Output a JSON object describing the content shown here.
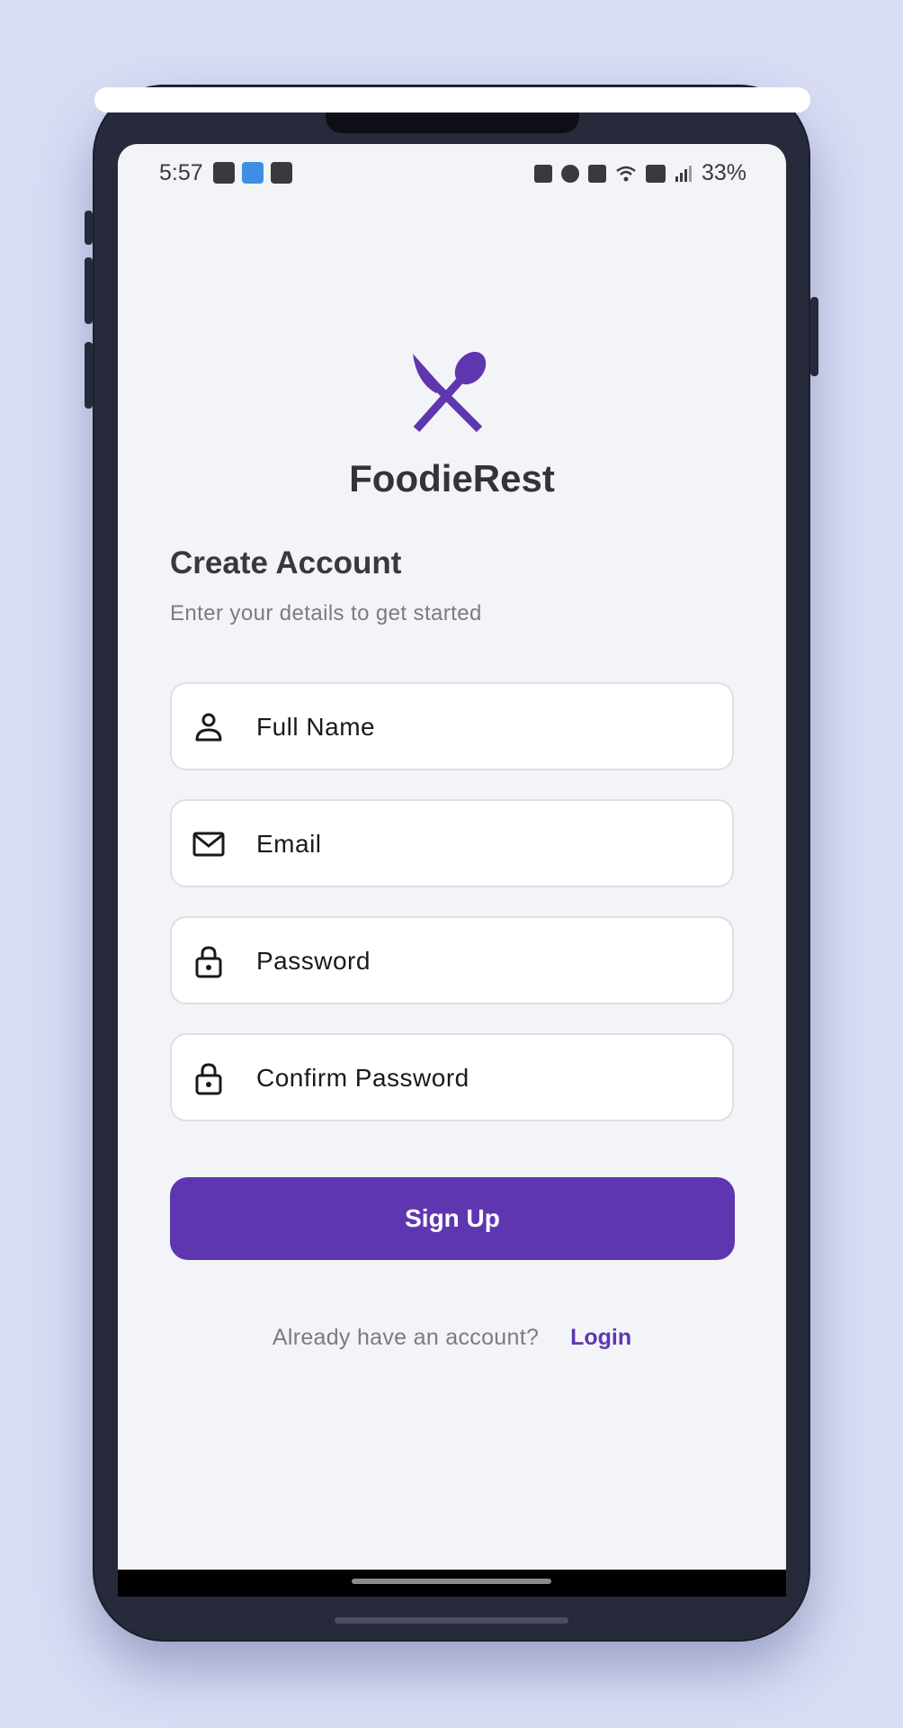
{
  "status_bar": {
    "time": "5:57",
    "left_icons": [
      "image-icon",
      "app-icon",
      "checkbox-icon"
    ],
    "right_icons": [
      "battery-saver-icon",
      "alarm-icon",
      "mute-icon",
      "wifi-icon",
      "volte-icon",
      "signal-icon"
    ],
    "battery": "33%"
  },
  "brand": {
    "logo_icon": "fork-spoon-icon",
    "name": "FoodieRest",
    "accent_color": "#5e37b0"
  },
  "form": {
    "title": "Create Account",
    "subtitle": "Enter your details to get started",
    "fields": [
      {
        "icon": "person-icon",
        "placeholder": "Full Name"
      },
      {
        "icon": "mail-icon",
        "placeholder": "Email"
      },
      {
        "icon": "lock-icon",
        "placeholder": "Password"
      },
      {
        "icon": "lock-icon",
        "placeholder": "Confirm Password"
      }
    ],
    "submit_label": "Sign Up"
  },
  "footer": {
    "question": "Already have an account?",
    "link_label": "Login"
  }
}
